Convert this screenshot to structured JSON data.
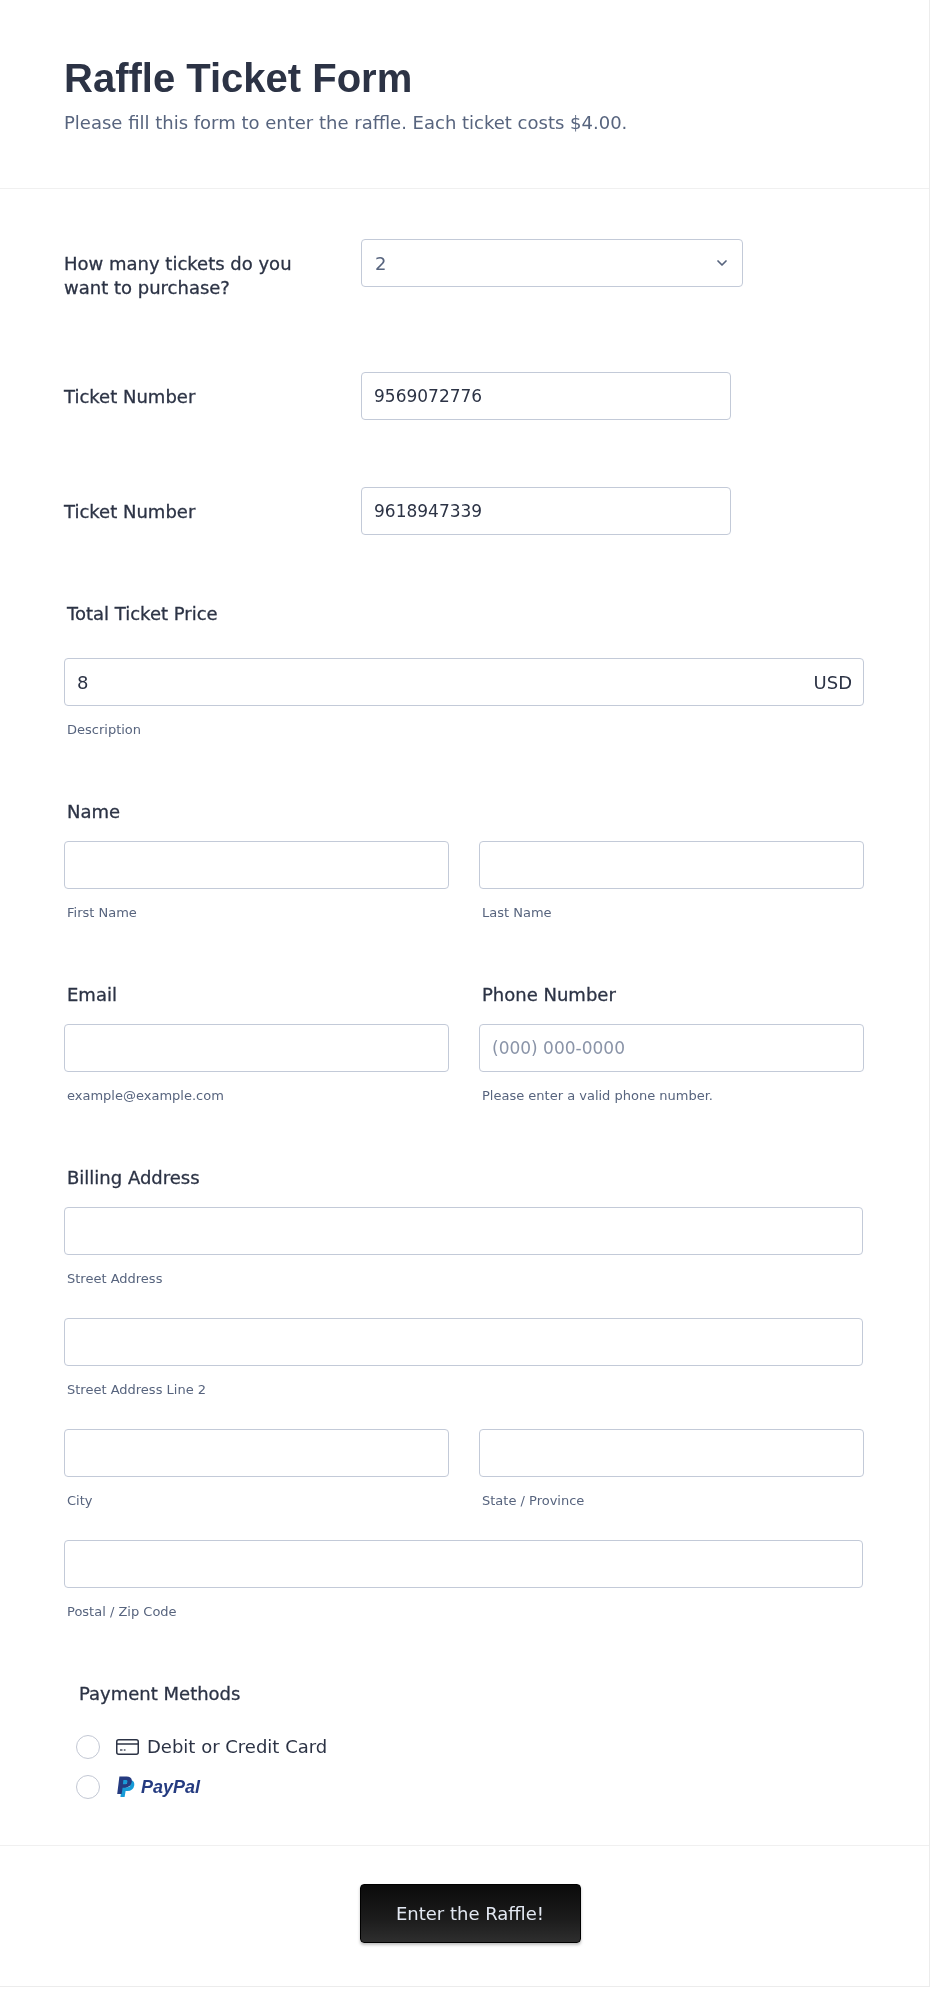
{
  "header": {
    "title": "Raffle Ticket Form",
    "subtitle": "Please fill this form to enter the raffle. Each ticket costs $4.00."
  },
  "ticket_fields": [
    {
      "kind": "select",
      "label": "How many tickets do you want to purchase?",
      "value": "2"
    },
    {
      "kind": "text",
      "label": "Ticket Number",
      "value": "9569072776"
    },
    {
      "kind": "text",
      "label": "Ticket Number",
      "value": "9618947339"
    }
  ],
  "total_price": {
    "label": "Total Ticket Price",
    "value": "8",
    "currency": "USD",
    "sublabel": "Description"
  },
  "name": {
    "label": "Name",
    "parts": [
      {
        "sublabel": "First Name"
      },
      {
        "sublabel": "Last Name"
      }
    ]
  },
  "contact": [
    {
      "label": "Email",
      "sublabel": "example@example.com"
    },
    {
      "label": "Phone Number",
      "placeholder": "(000) 000-0000",
      "sublabel": "Please enter a valid phone number."
    }
  ],
  "billing_address": {
    "label": "Billing Address",
    "rows": [
      {
        "fields": [
          {
            "sublabel": "Street Address"
          }
        ]
      },
      {
        "fields": [
          {
            "sublabel": "Street Address Line 2"
          }
        ]
      },
      {
        "fields": [
          {
            "sublabel": "City"
          },
          {
            "sublabel": "State / Province"
          }
        ]
      },
      {
        "fields": [
          {
            "sublabel": "Postal / Zip Code"
          }
        ]
      }
    ]
  },
  "payment": {
    "label": "Payment Methods",
    "options": [
      {
        "kind": "card",
        "label": "Debit or Credit Card",
        "selected": false
      },
      {
        "kind": "paypal",
        "label": "PayPal",
        "selected": false
      }
    ]
  },
  "submit": {
    "label": "Enter the Raffle!"
  }
}
